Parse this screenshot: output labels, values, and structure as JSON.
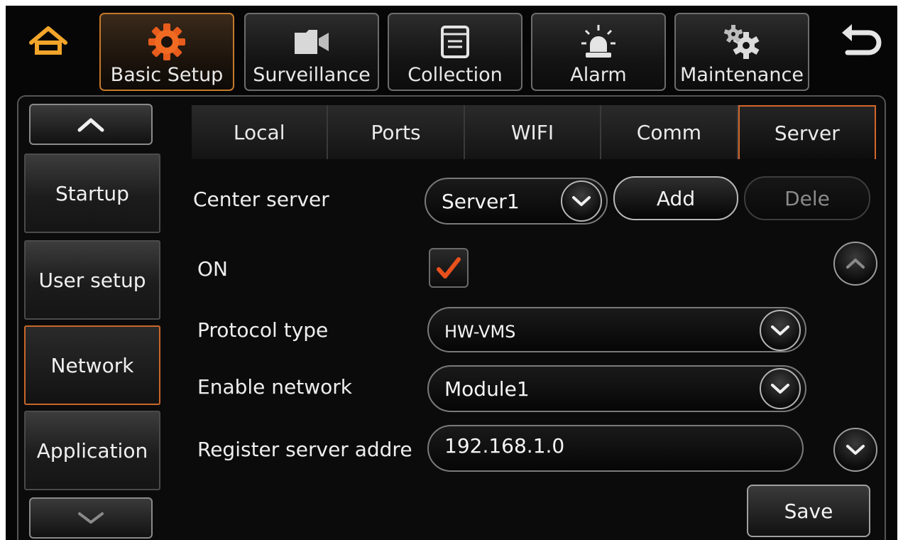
{
  "top_nav": {
    "home_icon": "home-icon",
    "back_icon": "back-arrow-icon",
    "tabs": [
      {
        "label": "Basic Setup",
        "icon": "gear-icon"
      },
      {
        "label": "Surveillance",
        "icon": "camera-icon"
      },
      {
        "label": "Collection",
        "icon": "document-icon"
      },
      {
        "label": "Alarm",
        "icon": "siren-icon"
      },
      {
        "label": "Maintenance",
        "icon": "gears-icon"
      }
    ],
    "active_tab": "Basic Setup"
  },
  "sidebar": {
    "items": [
      {
        "label": "Startup"
      },
      {
        "label": "User setup"
      },
      {
        "label": "Network"
      },
      {
        "label": "Application"
      }
    ],
    "active_item": "Network"
  },
  "subtabs": {
    "items": [
      {
        "label": "Local"
      },
      {
        "label": "Ports"
      },
      {
        "label": "WIFI"
      },
      {
        "label": "Comm"
      },
      {
        "label": "Server"
      }
    ],
    "active": "Server"
  },
  "form": {
    "center_server_label": "Center server",
    "center_server_value": "Server1",
    "add_label": "Add",
    "dele_label": "Dele",
    "on_label": "ON",
    "on_checked": true,
    "protocol_type_label": "Protocol type",
    "protocol_type_value": "HW-VMS",
    "enable_network_label": "Enable network",
    "enable_network_value": "Module1",
    "register_server_label": "Register server addre",
    "register_server_value": "192.168.1.0"
  },
  "save_label": "Save",
  "colors": {
    "accent": "#d2672b",
    "home_icon": "#f2a52a",
    "check": "#e8501c"
  }
}
